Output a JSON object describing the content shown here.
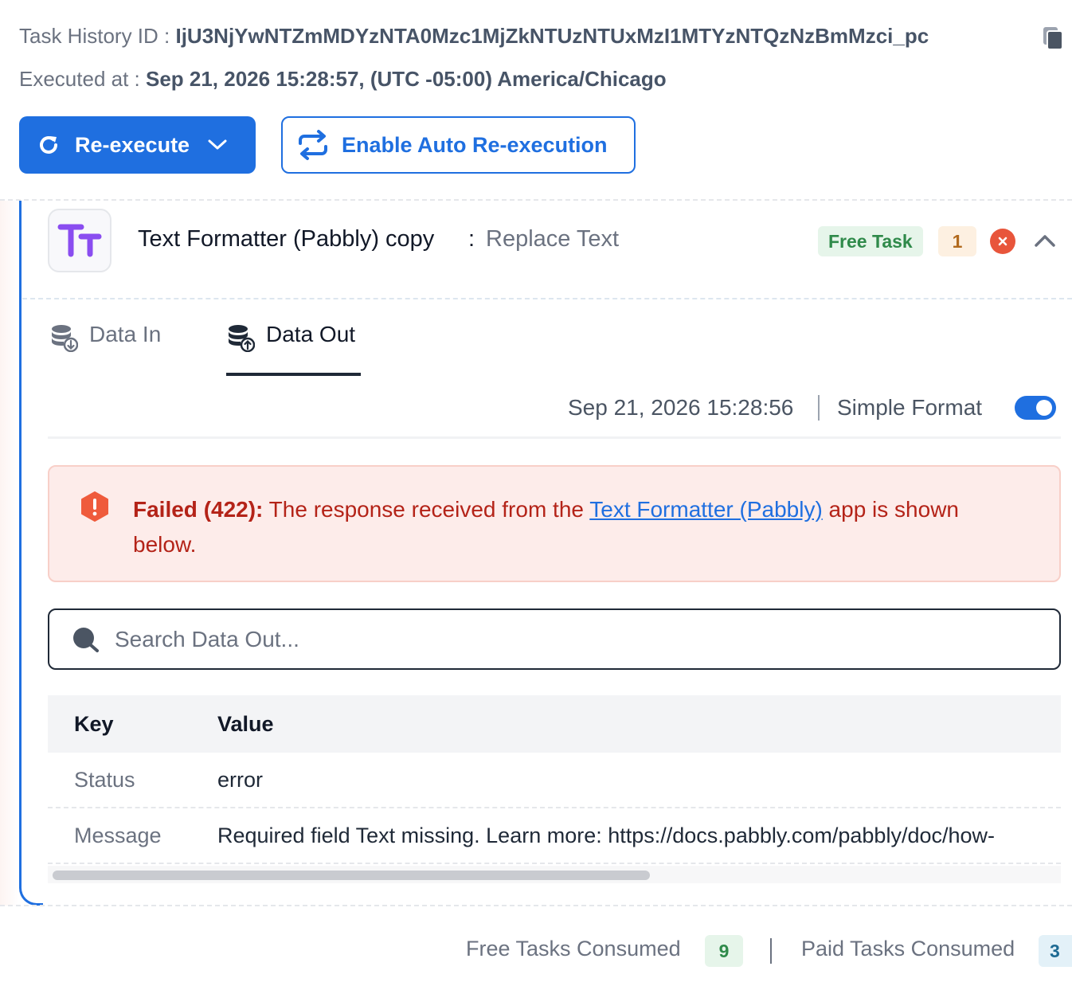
{
  "header": {
    "task_history_label": "Task History ID : ",
    "task_history_id": "IjU3NjYwNTZmMDYzNTA0Mzc1MjZkNTUzNTUxMzI1MTYzNTQzNzBmMzci_pc",
    "executed_label": "Executed at : ",
    "executed_value": "Sep 21, 2026 15:28:57, (UTC -05:00) America/Chicago"
  },
  "actions": {
    "reexecute_label": "Re-execute",
    "auto_reexecution_label": "Enable Auto Re-execution"
  },
  "step": {
    "app_name": "Text Formatter (Pabbly) copy",
    "separator": ":",
    "action_name": "Replace Text",
    "free_badge": "Free Task",
    "step_count": "1",
    "tabs": [
      {
        "label": "Data In"
      },
      {
        "label": "Data Out"
      }
    ],
    "timestamp": "Sep 21, 2026 15:28:56",
    "format_label": "Simple Format",
    "simple_format_on": true
  },
  "alert": {
    "status": "Failed (422):",
    "text_before": " The response received from the ",
    "link_text": "Text Formatter (Pabbly)",
    "text_after": " app is shown below."
  },
  "search": {
    "placeholder": "Search Data Out..."
  },
  "table": {
    "headers": {
      "key": "Key",
      "value": "Value"
    },
    "rows": [
      {
        "key": "Status",
        "value": "error"
      },
      {
        "key": "Message",
        "value": "Required field Text missing. Learn more: https://docs.pabbly.com/pabbly/doc/how-"
      }
    ]
  },
  "footer": {
    "free_label": "Free Tasks Consumed",
    "free_count": "9",
    "paid_label": "Paid Tasks Consumed",
    "paid_count": "3"
  },
  "colors": {
    "primary": "#1f6fe0",
    "error": "#e8553b",
    "alert_text": "#b42318",
    "free_badge_bg": "#e6f5ea",
    "free_badge_text": "#2f8a4a"
  }
}
